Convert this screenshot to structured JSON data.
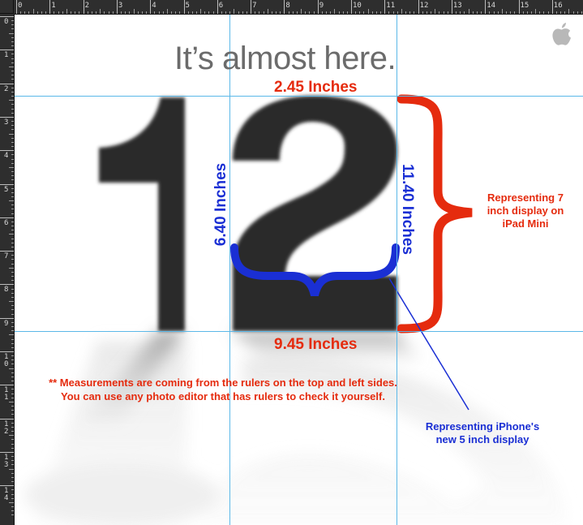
{
  "rulers": {
    "top_labels": [
      "0",
      "1",
      "2",
      "3",
      "4",
      "5",
      "6",
      "7",
      "8",
      "9",
      "10",
      "11",
      "12",
      "13",
      "14",
      "15",
      "16"
    ],
    "left_labels": [
      "0",
      "1",
      "2",
      "3",
      "4",
      "5",
      "6",
      "7",
      "8",
      "9",
      "10",
      "11",
      "12",
      "13",
      "14"
    ]
  },
  "poster": {
    "headline": "It’s almost here.",
    "big_number": "12",
    "logo": "apple-logo-icon"
  },
  "annotations": {
    "top_width": "2.45 Inches",
    "bottom_width": "9.45 Inches",
    "left_height": "6.40 Inches",
    "right_height": "11.40 Inches",
    "ipad_note": "Representing 7 inch display on iPad Mini",
    "iphone_note": "Representing iPhone's new 5 inch display",
    "measurement_note_line1": "** Measurements are coming from the rulers on the top and left sides.",
    "measurement_note_line2": "You can use any photo editor that has rulers to check it yourself."
  },
  "colors": {
    "red": "#e52b0e",
    "blue": "#1a2fd4",
    "guide": "#5bb8e8",
    "ruler": "#2e2e2e",
    "digits": "#2b2b2b"
  }
}
